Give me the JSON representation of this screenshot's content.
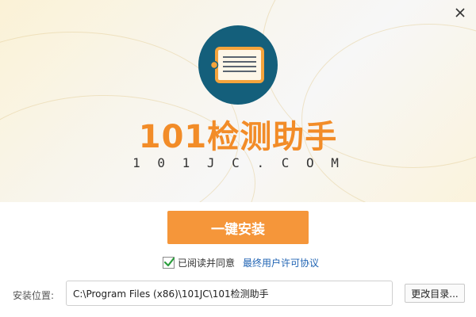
{
  "app": {
    "name": "101检测助手",
    "domain": "1 0 1 J   C . C O M"
  },
  "actions": {
    "install_label": "一键安装",
    "browse_label": "更改目录..."
  },
  "agreement": {
    "checked": true,
    "text": "已阅读并同意",
    "link_text": "最终用户许可协议"
  },
  "install_path": {
    "label": "安装位置:",
    "value": "C:\\Program Files (x86)\\101JC\\101检测助手"
  },
  "colors": {
    "brand_orange": "#f28c28",
    "button_orange": "#f5963a",
    "logo_teal": "#145f7b",
    "link_blue": "#1f63b3",
    "check_green": "#2a9d3c"
  },
  "icons": {
    "close": "close-icon",
    "logo": "document-logo-icon",
    "check": "checkmark-icon"
  }
}
